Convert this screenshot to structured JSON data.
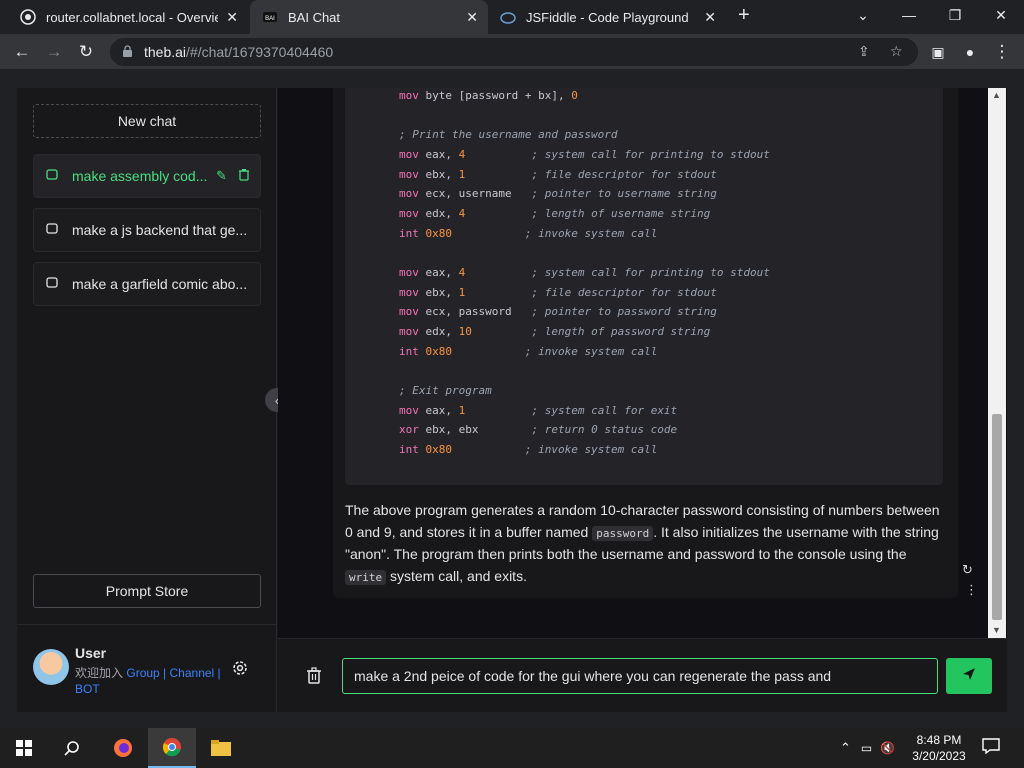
{
  "browser": {
    "tabs": [
      {
        "title": "router.collabnet.local - Overview",
        "icon": "router-icon",
        "active": false
      },
      {
        "title": "BAI Chat",
        "icon": "bai-icon",
        "active": true
      },
      {
        "title": "JSFiddle - Code Playground",
        "icon": "jsfiddle-icon",
        "active": false
      }
    ],
    "new_tab": "+",
    "url_host": "theb.ai",
    "url_path": "/#/chat/1679370404460"
  },
  "sidebar": {
    "new_chat": "New chat",
    "chats": [
      {
        "label": "make assembly cod...",
        "active": true
      },
      {
        "label": "make a js backend that ge...",
        "active": false
      },
      {
        "label": "make a garfield comic abo...",
        "active": false
      }
    ],
    "prompt_store": "Prompt Store",
    "user": {
      "name": "User",
      "welcome": "欢迎加入",
      "group": "Group",
      "sep1": " | ",
      "channel": "Channel",
      "sep2": " |",
      "bot": "BOT"
    }
  },
  "code_lines": [
    {
      "kw": "mov",
      "rest": " byte [password + bx], ",
      "num": "0",
      "comment": ""
    },
    {
      "kw": "",
      "rest": "",
      "num": "",
      "comment": ""
    },
    {
      "kw": "",
      "rest": "",
      "num": "",
      "comment": "; Print the username and password"
    },
    {
      "kw": "mov",
      "rest": " eax, ",
      "num": "4",
      "pad": "          ",
      "comment": "; system call for printing to stdout"
    },
    {
      "kw": "mov",
      "rest": " ebx, ",
      "num": "1",
      "pad": "          ",
      "comment": "; file descriptor for stdout"
    },
    {
      "kw": "mov",
      "rest": " ecx, username",
      "num": "",
      "pad": "   ",
      "comment": "; pointer to username string"
    },
    {
      "kw": "mov",
      "rest": " edx, ",
      "num": "4",
      "pad": "          ",
      "comment": "; length of username string"
    },
    {
      "kw": "int",
      "rest": " ",
      "num": "0x80",
      "pad": "           ",
      "comment": "; invoke system call"
    },
    {
      "kw": "",
      "rest": "",
      "num": "",
      "comment": ""
    },
    {
      "kw": "mov",
      "rest": " eax, ",
      "num": "4",
      "pad": "          ",
      "comment": "; system call for printing to stdout"
    },
    {
      "kw": "mov",
      "rest": " ebx, ",
      "num": "1",
      "pad": "          ",
      "comment": "; file descriptor for stdout"
    },
    {
      "kw": "mov",
      "rest": " ecx, password",
      "num": "",
      "pad": "   ",
      "comment": "; pointer to password string"
    },
    {
      "kw": "mov",
      "rest": " edx, ",
      "num": "10",
      "pad": "         ",
      "comment": "; length of password string"
    },
    {
      "kw": "int",
      "rest": " ",
      "num": "0x80",
      "pad": "           ",
      "comment": "; invoke system call"
    },
    {
      "kw": "",
      "rest": "",
      "num": "",
      "comment": ""
    },
    {
      "kw": "",
      "rest": "",
      "num": "",
      "comment": "; Exit program"
    },
    {
      "kw": "mov",
      "rest": " eax, ",
      "num": "1",
      "pad": "          ",
      "comment": "; system call for exit"
    },
    {
      "kw": "xor",
      "rest": " ebx, ebx",
      "num": "",
      "pad": "        ",
      "comment": "; return 0 status code"
    },
    {
      "kw": "int",
      "rest": " ",
      "num": "0x80",
      "pad": "           ",
      "comment": "; invoke system call"
    }
  ],
  "message": {
    "part1": "The above program generates a random 10-character password consisting of numbers between 0 and 9, and stores it in a buffer named ",
    "code1": "password",
    "part2": ". It also initializes the username with the string \"anon\". The program then prints both the username and password to the console using the ",
    "code2": "write",
    "part3": " system call, and exits."
  },
  "input": {
    "value": "make a 2nd peice of code for the gui where you can regenerate the pass and"
  },
  "taskbar": {
    "time": "8:48 PM",
    "date": "3/20/2023"
  },
  "colors": {
    "accent": "#22c55e",
    "keyword": "#f472b6",
    "number": "#fb923c"
  }
}
